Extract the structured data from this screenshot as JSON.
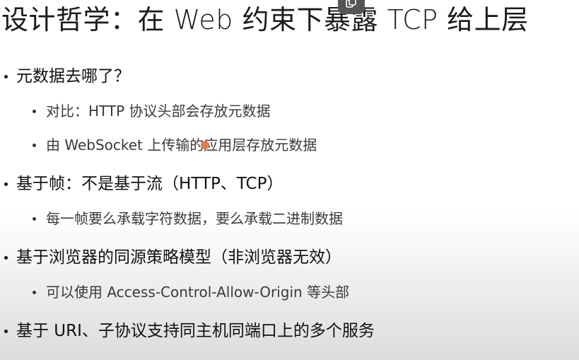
{
  "title": "设计哲学：在 Web 约束下暴露 TCP 给上层",
  "bullets": [
    {
      "text": "元数据去哪了？",
      "children": [
        "对比：HTTP 协议头部会存放元数据",
        "由 WebSocket 上传输的应用层存放元数据"
      ]
    },
    {
      "text": "基于帧：不是基于流（HTTP、TCP）",
      "children": [
        "每一帧要么承载字符数据，要么承载二进制数据"
      ]
    },
    {
      "text": "基于浏览器的同源策略模型（非浏览器无效）",
      "children": [
        "可以使用 Access-Control-Allow-Origin 等头部"
      ]
    },
    {
      "text": "基于 URI、子协议支持同主机同端口上的多个服务",
      "children": []
    }
  ],
  "icons": {
    "floating_button": "copy-icon",
    "pointer": "cursor-icon"
  },
  "colors": {
    "text": "#111111",
    "subtext": "#3a3a3a",
    "floating_button_bg": "#555555",
    "pointer": "#e8743b"
  }
}
